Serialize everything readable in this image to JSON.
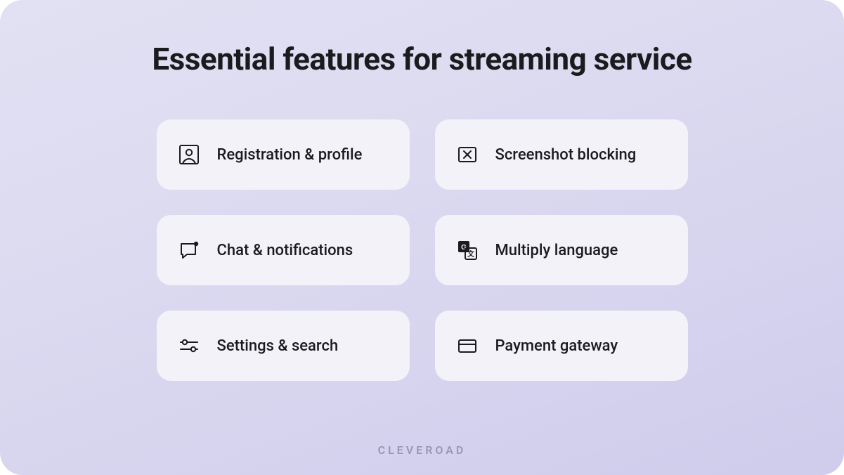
{
  "title": "Essential features for streaming service",
  "brand": "CLEVEROAD",
  "features": [
    {
      "label": "Registration & profile",
      "icon": "profile-icon"
    },
    {
      "label": "Screenshot blocking",
      "icon": "block-icon"
    },
    {
      "label": "Chat & notifications",
      "icon": "chat-icon"
    },
    {
      "label": "Multiply language",
      "icon": "translate-icon"
    },
    {
      "label": "Settings & search",
      "icon": "sliders-icon"
    },
    {
      "label": "Payment gateway",
      "icon": "card-icon"
    }
  ]
}
